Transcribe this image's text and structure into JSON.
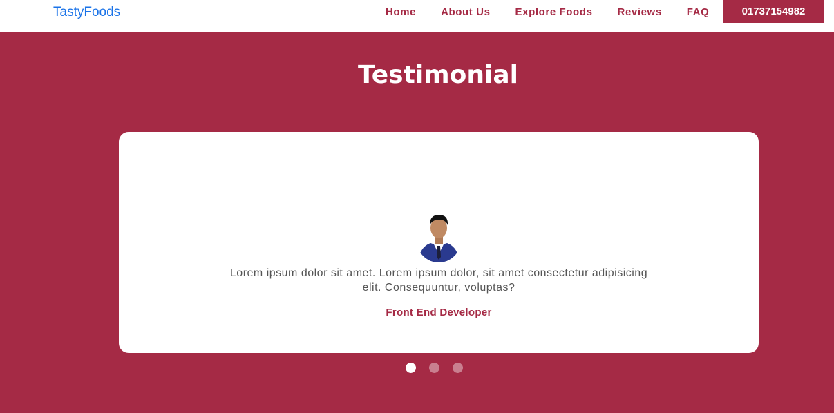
{
  "navbar": {
    "brand": "TastyFoods",
    "links": [
      "Home",
      "About Us",
      "Explore Foods",
      "Reviews",
      "FAQ"
    ],
    "phone": "01737154982"
  },
  "testimonial": {
    "title": "Testimonial",
    "quote": "Lorem ipsum dolor sit amet. Lorem ipsum dolor, sit amet consectetur adipisicing elit. Consequuntur, voluptas?",
    "role": "Front End Developer",
    "slides": 3,
    "active_slide": 1
  },
  "colors": {
    "primary": "#a52a45",
    "brand": "#1a73e8",
    "card": "#ffffff"
  }
}
